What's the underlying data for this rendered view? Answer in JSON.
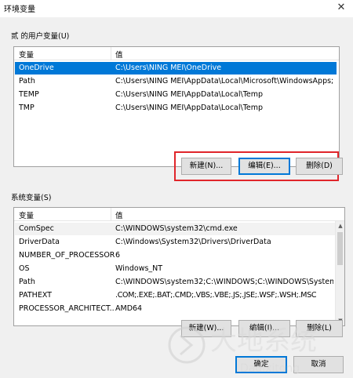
{
  "window": {
    "title": "环境变量",
    "close_glyph": "✕"
  },
  "user_vars": {
    "group_label": "贰 的用户变量(U)",
    "columns": [
      "变量",
      "值"
    ],
    "rows": [
      {
        "name": "OneDrive",
        "value": "C:\\Users\\NING MEI\\OneDrive",
        "selected": true
      },
      {
        "name": "Path",
        "value": "C:\\Users\\NING MEI\\AppData\\Local\\Microsoft\\WindowsApps;"
      },
      {
        "name": "TEMP",
        "value": "C:\\Users\\NING MEI\\AppData\\Local\\Temp"
      },
      {
        "name": "TMP",
        "value": "C:\\Users\\NING MEI\\AppData\\Local\\Temp"
      }
    ],
    "buttons": {
      "new": "新建(N)...",
      "edit": "编辑(E)...",
      "delete": "删除(D)"
    }
  },
  "system_vars": {
    "group_label": "系统变量(S)",
    "columns": [
      "变量",
      "值"
    ],
    "rows": [
      {
        "name": "ComSpec",
        "value": "C:\\WINDOWS\\system32\\cmd.exe"
      },
      {
        "name": "DriverData",
        "value": "C:\\Windows\\System32\\Drivers\\DriverData"
      },
      {
        "name": "NUMBER_OF_PROCESSORS",
        "value": "6"
      },
      {
        "name": "OS",
        "value": "Windows_NT"
      },
      {
        "name": "Path",
        "value": "C:\\WINDOWS\\system32;C:\\WINDOWS;C:\\WINDOWS\\System..."
      },
      {
        "name": "PATHEXT",
        "value": ".COM;.EXE;.BAT;.CMD;.VBS;.VBE;.JS;.JSE;.WSF;.WSH;.MSC"
      },
      {
        "name": "PROCESSOR_ARCHITECT...",
        "value": "AMD64"
      }
    ],
    "buttons": {
      "new": "新建(W)...",
      "edit": "编辑(I)...",
      "delete": "删除(L)"
    }
  },
  "footer": {
    "ok": "确定",
    "cancel": "取消"
  },
  "watermark": {
    "text_cn": "大地系统",
    "text_en": "Dadixitong"
  },
  "colors": {
    "selection": "#0078d7",
    "highlight_box": "#e0262b",
    "focus_border": "#0078d7"
  }
}
